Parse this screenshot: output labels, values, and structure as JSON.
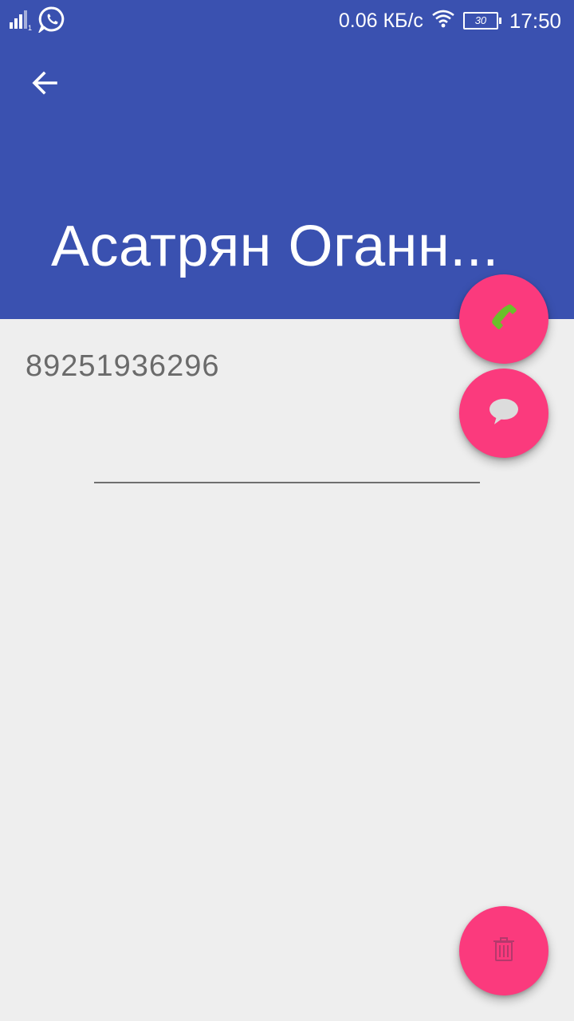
{
  "status_bar": {
    "net_speed": "0.06 КБ/с",
    "battery": "30",
    "time": "17:50",
    "icons": [
      "signal-icon",
      "whatsapp-icon",
      "wifi-icon",
      "battery-icon"
    ]
  },
  "toolbar": {
    "back_icon": "arrow-left-icon",
    "title": "Асатрян Оганн..."
  },
  "contact": {
    "phone": "89251936296"
  },
  "actions": {
    "call_icon": "phone-icon",
    "message_icon": "chat-bubble-icon",
    "delete_icon": "trash-icon"
  },
  "colors": {
    "header": "#3a51b0",
    "background": "#eeeeee",
    "fab": "#fb3a7d",
    "call_icon": "#6ac02a"
  }
}
